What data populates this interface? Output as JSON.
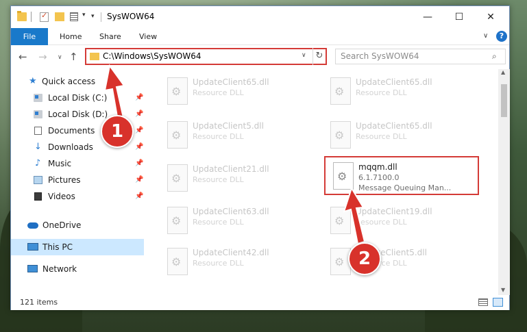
{
  "window": {
    "title": "SysWOW64",
    "controls": {
      "minimize": "—",
      "maximize": "☐",
      "close": "✕"
    }
  },
  "ribbon": {
    "tabs": [
      "File",
      "Home",
      "Share",
      "View"
    ],
    "expand_glyph": "∨",
    "help_glyph": "?"
  },
  "navigation": {
    "back": "←",
    "forward": "→",
    "recent": "∨",
    "up": "↑",
    "address": "C:\\Windows\\SysWOW64",
    "address_dropdown": "∨",
    "refresh": "↻",
    "search_placeholder": "Search SysWOW64",
    "search_icon": "⌕"
  },
  "sidebar": {
    "items": [
      {
        "label": "Quick access",
        "icon": "star-icon",
        "glyph": "★",
        "pinned": false
      },
      {
        "label": "Local Disk (C:)",
        "icon": "drive-icon",
        "pinned": true
      },
      {
        "label": "Local Disk (D:)",
        "icon": "drive-icon",
        "pinned": true
      },
      {
        "label": "Documents",
        "icon": "document-icon",
        "pinned": true
      },
      {
        "label": "Downloads",
        "icon": "download-icon",
        "glyph": "↓",
        "pinned": true
      },
      {
        "label": "Music",
        "icon": "music-icon",
        "glyph": "♪",
        "pinned": true
      },
      {
        "label": "Pictures",
        "icon": "pictures-icon",
        "pinned": true
      },
      {
        "label": "Videos",
        "icon": "videos-icon",
        "pinned": true
      },
      {
        "label": "OneDrive",
        "icon": "cloud-icon",
        "pinned": false
      },
      {
        "label": "This PC",
        "icon": "computer-icon",
        "pinned": false,
        "selected": true
      },
      {
        "label": "Network",
        "icon": "network-icon",
        "pinned": false
      }
    ],
    "pin_glyph": "📌"
  },
  "files": [
    {
      "name": "UpdateClient65.dll",
      "type": "Resource DLL"
    },
    {
      "name": "UpdateClient65.dll",
      "type": "Resource DLL"
    },
    {
      "name": "UpdateClient5.dll",
      "type": "Resource DLL"
    },
    {
      "name": "UpdateClient65.dll",
      "type": "Resource DLL"
    },
    {
      "name": "UpdateClient21.dll",
      "type": "Resource DLL"
    },
    {
      "name": "mqqm.dll",
      "version": "6.1.7100.0",
      "description": "Message Queuing Man..."
    },
    {
      "name": "UpdateClient63.dll",
      "type": "Resource DLL"
    },
    {
      "name": "UpdateClient19.dll",
      "type": "Resource DLL"
    },
    {
      "name": "UpdateClient42.dll",
      "type": "Resource DLL"
    },
    {
      "name": "UpdateClient5.dll",
      "type": "Resource DLL"
    }
  ],
  "status": {
    "item_count": "121 items"
  },
  "annotations": {
    "step1": "1",
    "step2": "2",
    "color": "#d8322b"
  }
}
